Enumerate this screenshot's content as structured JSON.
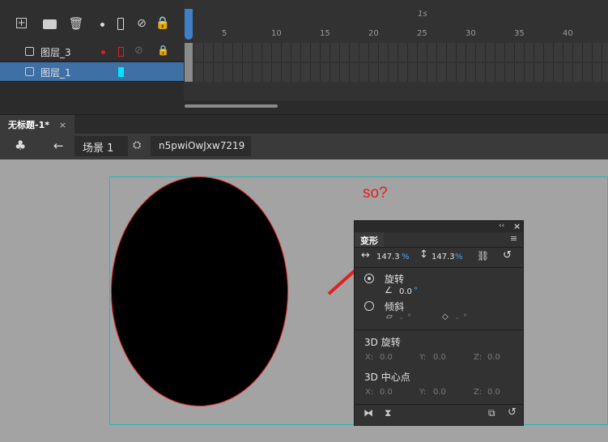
{
  "timeline": {
    "toolbar_icons": [
      "add-layer-icon",
      "folder-icon",
      "trash-icon",
      "dot-icon",
      "outline-icon",
      "eye-hidden-icon",
      "lock-icon"
    ],
    "layers": [
      {
        "name": "图层_3",
        "selected": false
      },
      {
        "name": "图层_1",
        "selected": true
      }
    ],
    "ruler": {
      "marker": "1s",
      "labels": [
        "5",
        "10",
        "15",
        "20",
        "25",
        "30",
        "35",
        "40"
      ]
    }
  },
  "tabbar": {
    "tab_label": "无标题-1*",
    "close": "×"
  },
  "breadcrumb": {
    "scene": "场景 1",
    "symbol": "n5pwiOwJxw7219"
  },
  "stage": {
    "annotation": "so?"
  },
  "transform_panel": {
    "title": "变形",
    "width_pct": "147.3",
    "height_pct": "147.3",
    "pct_unit": "%",
    "rotate_label": "旋转",
    "rotate_value": "0.0",
    "degree": "°",
    "skew_label": "倾斜",
    "skew_h": "-",
    "skew_v": "-",
    "rot3d_label": "3D 旋转",
    "center3d_label": "3D 中心点",
    "x_label": "X:",
    "y_label": "Y:",
    "z_label": "Z:",
    "rot3d_values": [
      "0.0",
      "0.0",
      "0.0"
    ],
    "center3d_values": [
      "0.0",
      "0.0",
      "0.0"
    ]
  }
}
